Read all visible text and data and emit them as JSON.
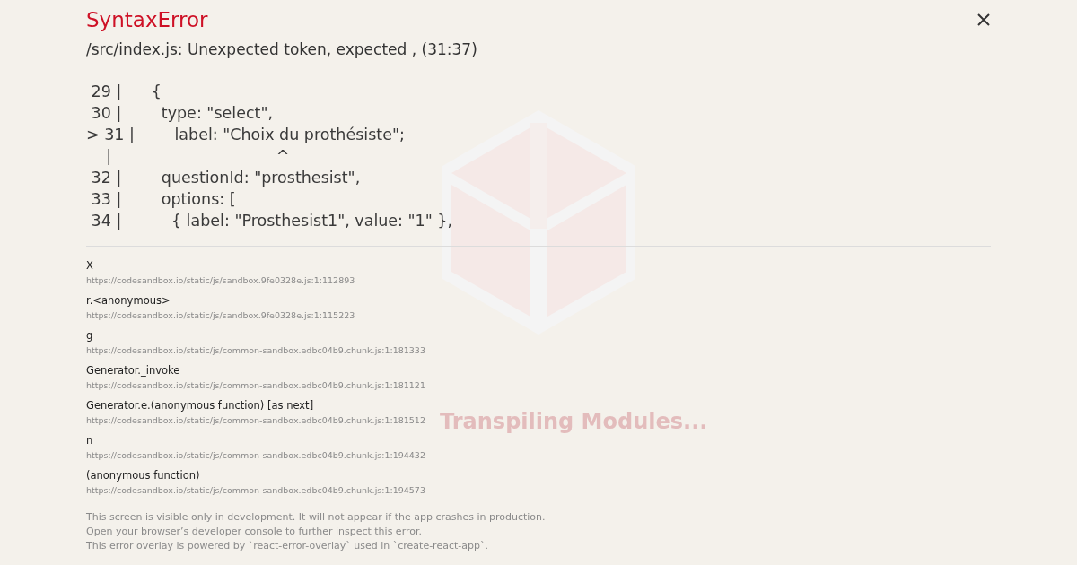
{
  "background": {
    "loading_text": "Transpiling Modules..."
  },
  "error": {
    "title": "SyntaxError",
    "message": "/src/index.js: Unexpected token, expected , (31:37)"
  },
  "code_frame": [
    " 29 |      {",
    " 30 |        type: \"select\",",
    "> 31 |        label: \"Choix du prothésiste\";",
    "    |                                 ^",
    " 32 |        questionId: \"prosthesist\",",
    " 33 |        options: [",
    " 34 |          { label: \"Prosthesist1\", value: \"1\" },"
  ],
  "stack_frames": [
    {
      "function": "X",
      "location": "https://codesandbox.io/static/js/sandbox.9fe0328e.js:1:112893"
    },
    {
      "function": "r.<anonymous>",
      "location": "https://codesandbox.io/static/js/sandbox.9fe0328e.js:1:115223"
    },
    {
      "function": "g",
      "location": "https://codesandbox.io/static/js/common-sandbox.edbc04b9.chunk.js:1:181333"
    },
    {
      "function": "Generator._invoke",
      "location": "https://codesandbox.io/static/js/common-sandbox.edbc04b9.chunk.js:1:181121"
    },
    {
      "function": "Generator.e.(anonymous function) [as next]",
      "location": "https://codesandbox.io/static/js/common-sandbox.edbc04b9.chunk.js:1:181512"
    },
    {
      "function": "n",
      "location": "https://codesandbox.io/static/js/common-sandbox.edbc04b9.chunk.js:1:194432"
    },
    {
      "function": "(anonymous function)",
      "location": "https://codesandbox.io/static/js/common-sandbox.edbc04b9.chunk.js:1:194573"
    }
  ],
  "footer": [
    "This screen is visible only in development. It will not appear if the app crashes in production.",
    "Open your browser’s developer console to further inspect this error.",
    "This error overlay is powered by `react-error-overlay` used in `create-react-app`."
  ]
}
